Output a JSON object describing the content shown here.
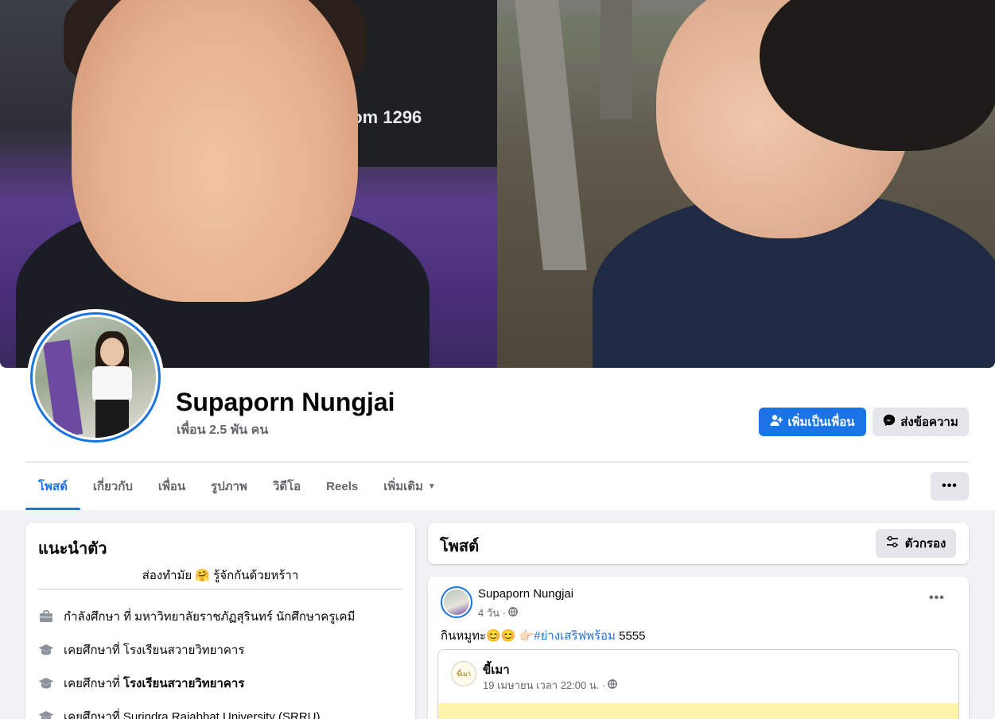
{
  "profile": {
    "name": "Supaporn Nungjai",
    "friends": "เพื่อน 2.5 พัน คน",
    "cover_sign_text": "com 1296"
  },
  "actions": {
    "add_friend": "เพิ่มเป็นเพื่อน",
    "message": "ส่งข้อความ",
    "more": "•••"
  },
  "tabs": [
    {
      "label": "โพสต์",
      "active": true
    },
    {
      "label": "เกี่ยวกับ"
    },
    {
      "label": "เพื่อน"
    },
    {
      "label": "รูปภาพ"
    },
    {
      "label": "วิดีโอ"
    },
    {
      "label": "Reels"
    },
    {
      "label": "เพิ่มเติม"
    }
  ],
  "intro": {
    "title": "แนะนำตัว",
    "bio": "ส่องทำมัย 🤗 รู้จักกันด้วยหร้าา",
    "items": [
      {
        "icon": "briefcase-icon",
        "text": "กำลังศึกษา ที่ มหาวิทยาลัยราชภัฏสุรินทร์ นักศึกษาครูเคมี"
      },
      {
        "icon": "graduation-cap-icon",
        "prefix": "เคยศึกษาที่ ",
        "place": "โรงเรียนสวายวิทยาคาร",
        "bold": false
      },
      {
        "icon": "graduation-cap-icon",
        "prefix": "เคยศึกษาที่ ",
        "place": "โรงเรียนสวายวิทยาคาร",
        "bold": true
      },
      {
        "icon": "graduation-cap-icon",
        "prefix": "เคยศึกษาที่ ",
        "place": "Surindra Rajabhat University (SRRU)",
        "bold": false
      }
    ]
  },
  "posts_header": {
    "title": "โพสต์",
    "filter": "ตัวกรอง"
  },
  "post": {
    "author": "Supaporn Nungjai",
    "time": "4 วัน ·",
    "text_prefix": "กินหมูทะ😊😊 👉🏻",
    "hashtag": "#ย่างเสริฟพร้อม",
    "text_suffix": " 5555",
    "shared": {
      "page_name": "ขี้เมา",
      "page_avatar_text": "ขี้เมา",
      "time": "19 เมษายน เวลา 22:00 น. ·"
    }
  },
  "colors": {
    "accent": "#1b74e4",
    "secondary_btn": "#e4e6eb",
    "page_bg": "#f0f2f5",
    "muted_text": "#65676b"
  }
}
